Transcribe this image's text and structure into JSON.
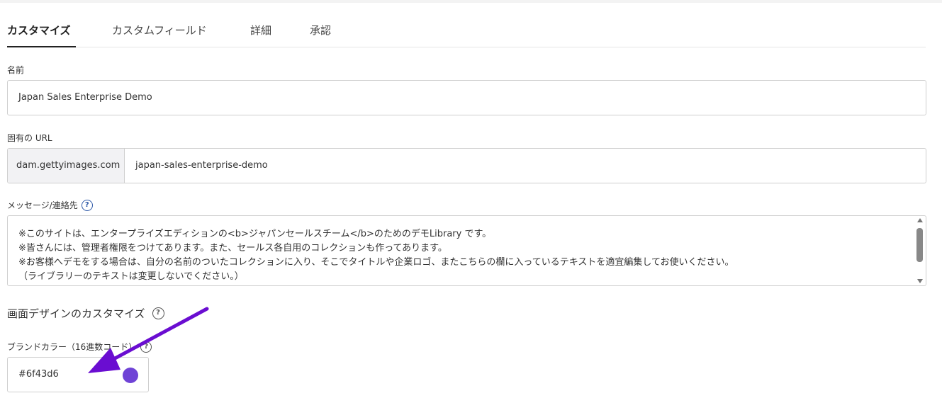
{
  "tabs": [
    {
      "label": "カスタマイズ",
      "active": true
    },
    {
      "label": "カスタムフィールド",
      "active": false
    },
    {
      "label": "詳細",
      "active": false
    },
    {
      "label": "承認",
      "active": false
    }
  ],
  "name_field": {
    "label": "名前",
    "value": "Japan Sales Enterprise Demo"
  },
  "url_field": {
    "label": "固有の URL",
    "prefix": "dam.gettyimages.com",
    "value": "japan-sales-enterprise-demo"
  },
  "message_field": {
    "label": "メッセージ/連絡先",
    "lines": [
      "※このサイトは、エンタープライズエディションの<b>ジャパンセールスチーム</b>のためのデモLibrary です。",
      "※皆さんには、管理者権限をつけてあります。また、セールス各自用のコレクションも作ってあります。",
      "※お客様へデモをする場合は、自分の名前のついたコレクションに入り、そこでタイトルや企業ロゴ、またこちらの欄に入っているテキストを適宜編集してお使いください。",
      "（ライブラリーのテキストは変更しないでください。）"
    ]
  },
  "design_section": {
    "title": "画面デザインのカスタマイズ"
  },
  "brand_color": {
    "label": "ブランドカラー（16進数コード）",
    "value": "#6f43d6",
    "swatch_color": "#6f43d6"
  },
  "help_icon_glyph": "?",
  "colors": {
    "arrow": "#6a0dd1",
    "help_blue": "#2f5aa8"
  }
}
